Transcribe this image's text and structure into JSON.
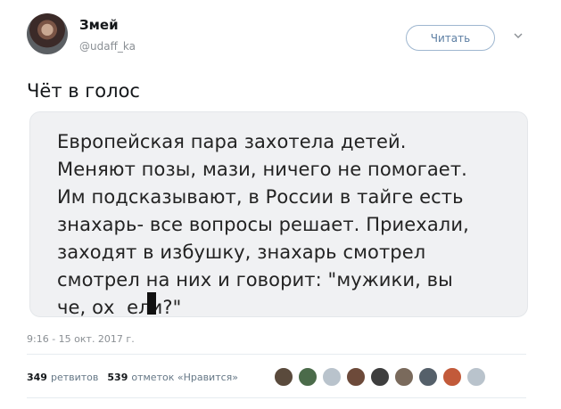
{
  "author": {
    "name": "Змей",
    "handle": "@udaff_ka"
  },
  "follow_button": {
    "label": "Читать"
  },
  "tweet": {
    "text": "Чёт в голос",
    "image_text": "Европейская пара захотела детей.\nМеняют позы, мази, ничего не помогает.\nИм подсказывают, в России в тайге есть\nзнахарь- все вопросы решает. Приехали,\nзаходят в избушку, знахарь смотрел\nсмотрел на них и говорит: \"мужики, вы\nче, ох  ели?\"",
    "timestamp": "9:16 - 15 окт. 2017 г."
  },
  "stats": {
    "retweets_count": "349",
    "retweets_label": "ретвитов",
    "likes_count": "539",
    "likes_label": "отметок «Нравится»"
  },
  "likers": [
    {
      "name": "liker-avatar-1",
      "color": "#5a4a3c"
    },
    {
      "name": "liker-avatar-2",
      "color": "#4b6b4a"
    },
    {
      "name": "liker-avatar-3",
      "color": "#b9c3cc"
    },
    {
      "name": "liker-avatar-4",
      "color": "#6d4a3a"
    },
    {
      "name": "liker-avatar-5",
      "color": "#3e3e3e"
    },
    {
      "name": "liker-avatar-6",
      "color": "#7a6a5c"
    },
    {
      "name": "liker-avatar-7",
      "color": "#55606a"
    },
    {
      "name": "liker-avatar-8",
      "color": "#c25a3a"
    },
    {
      "name": "liker-avatar-9",
      "color": "#b9c3cc"
    }
  ],
  "colors": {
    "link_blue": "#5c7ea3",
    "muted_gray": "#8a8f94"
  }
}
